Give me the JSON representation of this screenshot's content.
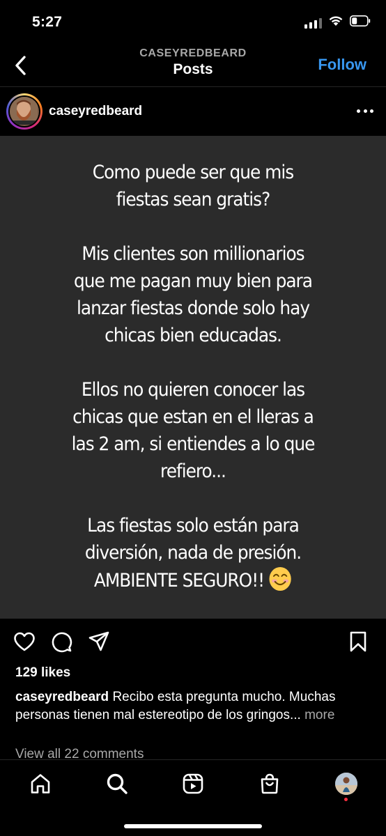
{
  "status_bar": {
    "time": "5:27",
    "icons": [
      "signal-icon",
      "wifi-icon",
      "battery-icon"
    ]
  },
  "header": {
    "username": "CASEYREDBEARD",
    "title": "Posts",
    "follow_label": "Follow",
    "back_icon": "chevron-left-icon"
  },
  "post": {
    "username": "caseyredbeard",
    "image_text": {
      "paragraph_1": [
        "Como puede ser que mis",
        "fiestas sean gratis?"
      ],
      "paragraph_2": [
        "Mis clientes son millionarios",
        "que me pagan muy bien para",
        "lanzar fiestas donde solo hay",
        "chicas bien educadas."
      ],
      "paragraph_3": [
        "Ellos no quieren conocer las",
        "chicas que estan en el lleras a",
        "las 2 am, si entiendes a lo que",
        "refiero..."
      ],
      "paragraph_4": [
        "Las fiestas solo están para",
        "diversión, nada de presión.",
        "AMBIENTE SEGURO!!"
      ]
    },
    "likes": "129 likes",
    "caption_user": "caseyredbeard",
    "caption_text": "Recibo esta pregunta mucho. Muchas personas tienen mal estereotipo de los gringos...",
    "caption_more": "more",
    "comments_link": "View all 22 comments"
  },
  "tab_bar": {
    "items": [
      "home-icon",
      "search-icon",
      "reels-icon",
      "shop-icon",
      "profile-avatar"
    ]
  },
  "colors": {
    "background": "#000000",
    "post_bg": "#2b2b2b",
    "link_blue": "#3897f0",
    "muted": "#a8a8a8"
  }
}
